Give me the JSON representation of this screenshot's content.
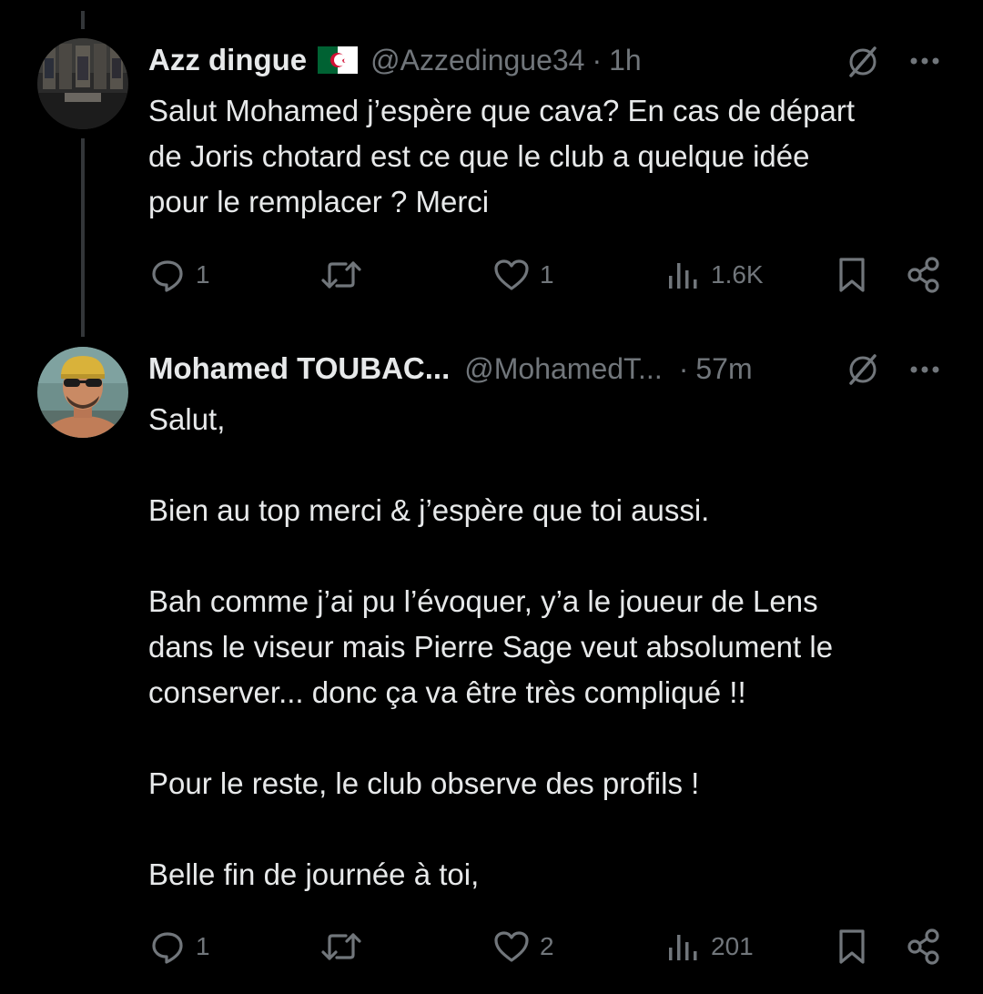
{
  "tweets": [
    {
      "display_name": "Azz dingue",
      "handle": "@Azzedingue34",
      "separator": "·",
      "time": "1h",
      "text": "Salut Mohamed j’espère que cava? En cas de départ\nde Joris chotard est ce que le club a quelque idée\npour le remplacer ? Merci",
      "replies": "1",
      "retweets": "",
      "likes": "1",
      "views": "1.6K",
      "flag_icon": "algeria-flag-icon",
      "avatar_icon": "locker-room-avatar"
    },
    {
      "display_name": "Mohamed TOUBAC...",
      "handle": "@MohamedT...",
      "separator": "·",
      "time": "57m",
      "text": "Salut,\n\nBien au top merci & j’espère que toi aussi.\n\nBah comme j’ai pu l’évoquer, y’a le joueur de Lens\ndans le viseur mais Pierre Sage veut absolument le\nconserver... donc ça va être très compliqué !!\n\nPour le reste, le club observe des profils !\n\nBelle fin de journée à toi,",
      "replies": "1",
      "retweets": "",
      "likes": "2",
      "views": "201",
      "avatar_icon": "person-with-cap-avatar"
    }
  ],
  "icons": {
    "grok": "grok-icon",
    "more": "more-icon",
    "reply": "reply-icon",
    "retweet": "retweet-icon",
    "like": "heart-icon",
    "views": "views-icon",
    "bookmark": "bookmark-icon",
    "share": "share-icon"
  },
  "colors": {
    "background": "#000000",
    "text_primary": "#e7e9ea",
    "text_secondary": "#71767b",
    "thread_line": "#333639"
  }
}
